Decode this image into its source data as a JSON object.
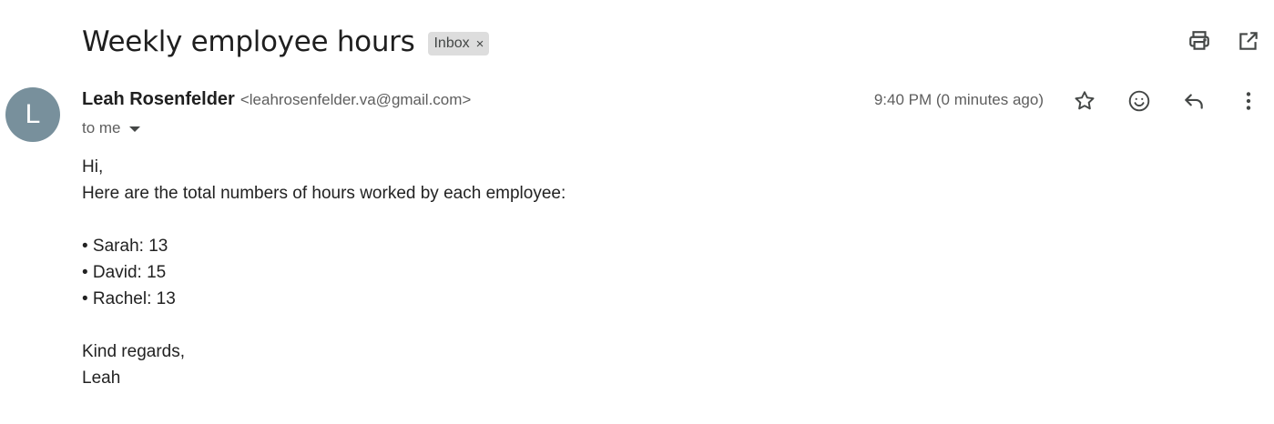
{
  "email": {
    "subject": "Weekly employee hours",
    "label": "Inbox",
    "label_remove": "×",
    "sender": {
      "initial": "L",
      "avatar_color": "#78909c",
      "name": "Leah Rosenfelder",
      "email": "<leahrosenfelder.va@gmail.com>"
    },
    "recipient": "to me",
    "timestamp": "9:40 PM (0 minutes ago)",
    "body": {
      "greeting": "Hi,",
      "intro": "Here are the total numbers of hours worked by each employee:",
      "items": [
        "• Sarah: 13",
        "• David: 15",
        "• Rachel: 13"
      ],
      "closing": "Kind regards,",
      "signature": "Leah"
    }
  },
  "toolbar": {
    "top_icons": [
      "print-icon",
      "open-in-new-window-icon"
    ],
    "action_icons": [
      "star-icon",
      "emoji-reaction-icon",
      "reply-icon",
      "more-options-icon"
    ]
  },
  "colors": {
    "label_chip_bg": "#dddddd",
    "text_primary": "#1f1f1f",
    "text_secondary": "#5e5e5e",
    "icon_color": "#444746"
  }
}
